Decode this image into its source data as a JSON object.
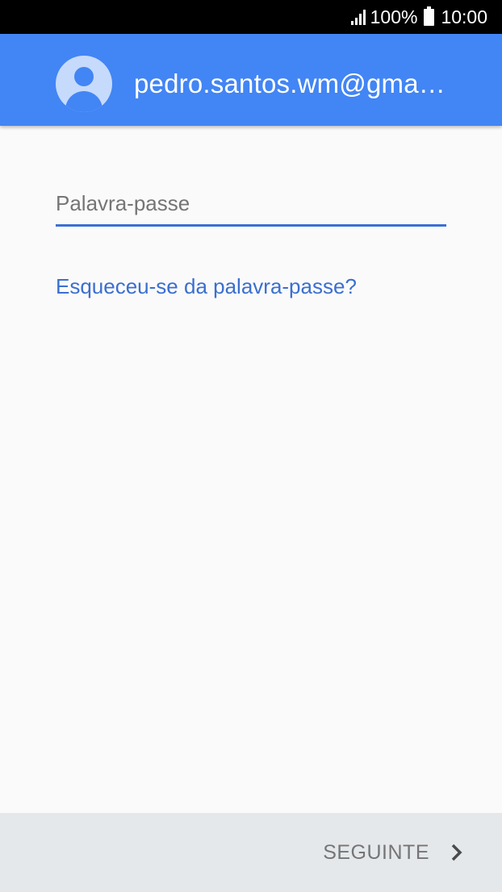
{
  "status_bar": {
    "battery": "100%",
    "time": "10:00",
    "icons": [
      "signal-icon",
      "battery-icon"
    ]
  },
  "header": {
    "avatar_icon": "account-avatar-icon",
    "account_email": "pedro.santos.wm@gma…"
  },
  "form": {
    "password_placeholder": "Palavra-passe",
    "password_value": "",
    "forgot_password_label": "Esqueceu-se da palavra-passe?"
  },
  "footer": {
    "next_label": "SEGUINTE",
    "next_icon": "chevron-right-icon"
  },
  "colors": {
    "app_bar": "#4285f4",
    "link": "#3b6fd0",
    "input_underline": "#3b70d6",
    "background": "#fafafa",
    "footer": "#e5e8eb"
  }
}
